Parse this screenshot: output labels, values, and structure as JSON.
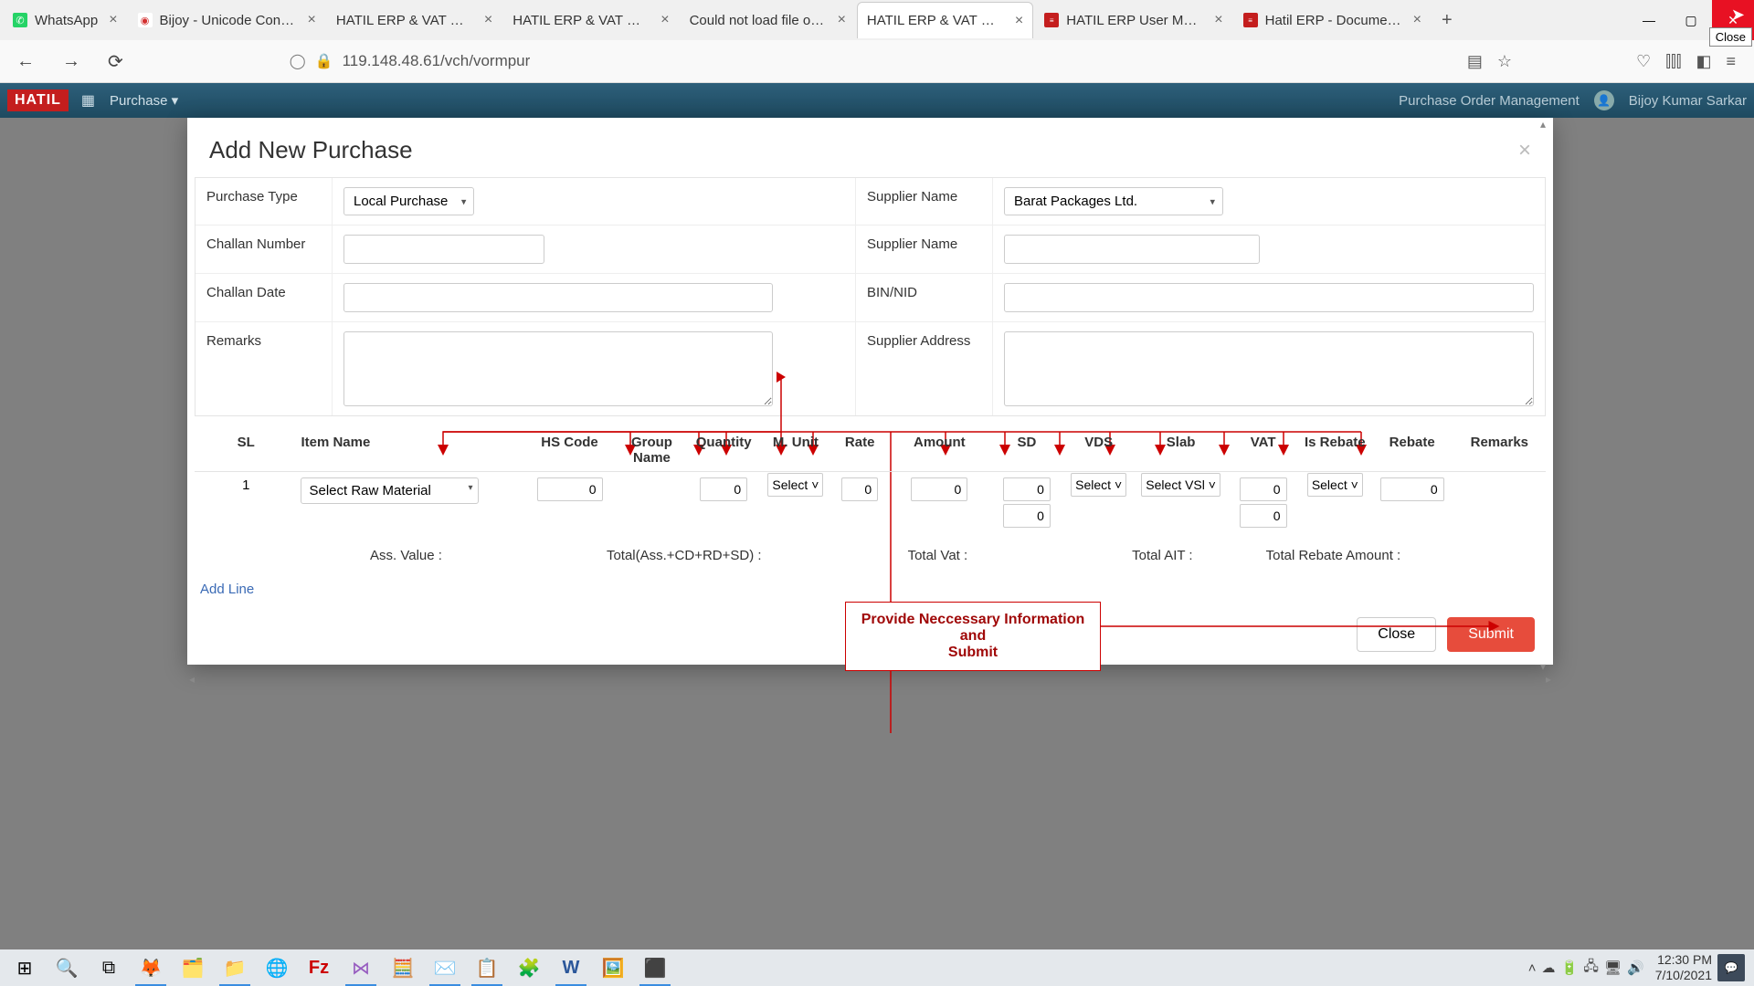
{
  "browser": {
    "tabs": [
      {
        "title": "WhatsApp",
        "favicon_bg": "#25d366",
        "favicon_char": "✆"
      },
      {
        "title": "Bijoy - Unicode Converter | fr",
        "favicon_bg": "#d32f2f",
        "favicon_char": "●"
      },
      {
        "title": "HATIL ERP & VAT Management Sy",
        "favicon_bg": "#fff",
        "favicon_char": ""
      },
      {
        "title": "HATIL ERP & VAT Management Sy",
        "favicon_bg": "#fff",
        "favicon_char": ""
      },
      {
        "title": "Could not load file or assembly 'S",
        "favicon_bg": "#fff",
        "favicon_char": ""
      },
      {
        "title": "HATIL ERP & VAT Management Sy",
        "favicon_bg": "#fff",
        "favicon_char": "",
        "active": true
      },
      {
        "title": "HATIL ERP User Menual",
        "favicon_bg": "#c41e1e",
        "favicon_char": "≡"
      },
      {
        "title": "Hatil ERP - Documentation",
        "favicon_bg": "#c41e1e",
        "favicon_char": "≡"
      }
    ],
    "url": "119.148.48.61/vch/vormpur",
    "close_tooltip": "Close"
  },
  "app_header": {
    "logo": "HATIL",
    "menu_purchase": "Purchase ▾",
    "right_text": "Purchase Order Management",
    "user_name": "Bijoy Kumar Sarkar"
  },
  "modal": {
    "title": "Add New Purchase",
    "left": {
      "purchase_type_label": "Purchase Type",
      "purchase_type_value": "Local Purchase",
      "challan_number_label": "Challan Number",
      "challan_number_value": "",
      "challan_date_label": "Challan Date",
      "challan_date_value": "",
      "remarks_label": "Remarks",
      "remarks_value": ""
    },
    "right": {
      "supplier_name_label": "Supplier Name",
      "supplier_name_value": "Barat Packages Ltd.",
      "supplier_name2_label": "Supplier Name",
      "supplier_name2_value": "",
      "bin_nid_label": "BIN/NID",
      "bin_nid_value": "",
      "supplier_address_label": "Supplier Address",
      "supplier_address_value": ""
    },
    "grid": {
      "headers": {
        "sl": "SL",
        "item_name": "Item Name",
        "hs_code": "HS Code",
        "group_name": "Group Name",
        "quantity": "Quantity",
        "m_unit": "M. Unit",
        "rate": "Rate",
        "amount": "Amount",
        "sd": "SD",
        "vds": "VDS",
        "slab": "Slab",
        "vat": "VAT",
        "is_rebate": "Is Rebate",
        "rebate": "Rebate",
        "remarks": "Remarks"
      },
      "rows": [
        {
          "sl": "1",
          "item_name": "Select Raw Material",
          "hs_code": "0",
          "quantity": "0",
          "m_unit": "Select ˅",
          "rate": "0",
          "amount": "0",
          "sd_top": "0",
          "sd_bottom": "0",
          "vds": "Select ˅",
          "slab": "Select VSl ˅",
          "vat_top": "0",
          "vat_bottom": "0",
          "is_rebate": "Select ˅",
          "rebate": "0"
        }
      ],
      "totals": {
        "ass_value": "Ass. Value :",
        "total_acd": "Total(Ass.+CD+RD+SD) :",
        "total_vat": "Total Vat :",
        "total_ait": "Total AIT :",
        "total_rebate": "Total Rebate Amount :"
      },
      "add_line": "Add Line"
    },
    "callout_text1": "Provide Neccessary Information and",
    "callout_text2": "Submit",
    "close_btn": "Close",
    "submit_btn": "Submit"
  },
  "taskbar": {
    "time": "12:30 PM",
    "date": "7/10/2021"
  }
}
